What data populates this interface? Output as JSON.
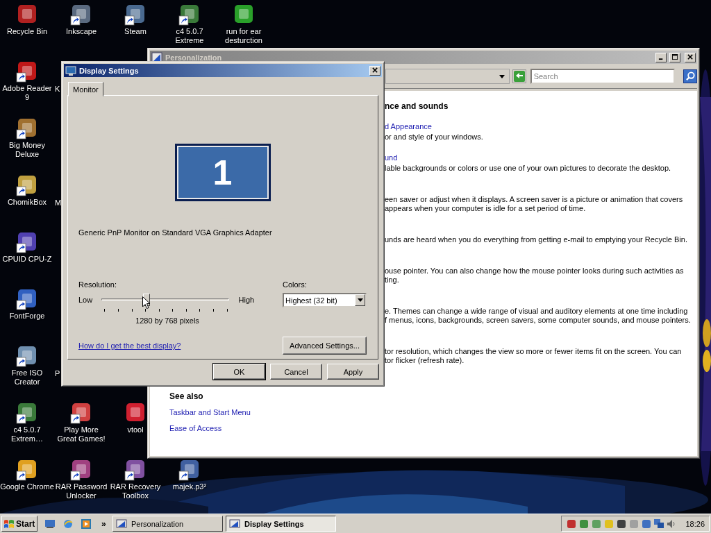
{
  "desktop_icons": [
    {
      "label": "Recycle Bin",
      "shortcut": false
    },
    {
      "label": "Inkscape",
      "shortcut": true
    },
    {
      "label": "Steam",
      "shortcut": true
    },
    {
      "label": "c4 5.0.7 Extreme",
      "shortcut": true
    },
    {
      "label": "run for ear desturction",
      "shortcut": false
    },
    {
      "label": "Adobe Reader 9",
      "shortcut": true
    },
    {
      "label": "K",
      "kind": "partial"
    },
    {
      "label": "Big Money Deluxe",
      "shortcut": true
    },
    {
      "label": "ChomikBox",
      "shortcut": true
    },
    {
      "label": "M",
      "kind": "partial"
    },
    {
      "label": "CPUID CPU-Z",
      "shortcut": true
    },
    {
      "label": "FontForge",
      "shortcut": true
    },
    {
      "label": "Free ISO Creator",
      "shortcut": true
    },
    {
      "label": "P",
      "kind": "partial"
    },
    {
      "label": "c4 5.0.7 Extrem…",
      "shortcut": true
    },
    {
      "label": "Play More Great Games!",
      "shortcut": true
    },
    {
      "label": "vtool",
      "shortcut": false
    },
    {
      "label": "Google Chrome",
      "shortcut": true
    },
    {
      "label": "RAR Password Unlocker",
      "shortcut": true
    },
    {
      "label": "RAR Recovery Toolbox",
      "shortcut": true
    },
    {
      "label": "majek.p3²",
      "shortcut": true
    }
  ],
  "personalization_window": {
    "title": "Personalization",
    "active": false,
    "search": {
      "placeholder": "Search"
    },
    "heading": "nce and sounds",
    "sections": [
      {
        "link": "d Appearance",
        "lines": [
          "or and style of your windows."
        ]
      },
      {
        "link": "und",
        "lines": [
          "lable backgrounds or colors or use one of your own pictures to decorate the desktop."
        ]
      },
      {
        "lines": [
          "een saver or adjust when it displays. A screen saver is a picture or animation that covers",
          "appears when your computer is idle for a set period of time."
        ]
      },
      {
        "lines": [
          "unds are heard when you do everything from getting e-mail to emptying your Recycle Bin."
        ]
      },
      {
        "lines": [
          "ouse pointer. You can also change how the mouse pointer looks during such activities as",
          "ting."
        ]
      },
      {
        "lines": [
          "e. Themes can change a wide range of visual and auditory elements at one time including",
          "f menus, icons, backgrounds, screen savers, some computer sounds, and mouse pointers."
        ]
      },
      {
        "lines": [
          "tor resolution, which changes the view so more or fewer items fit on the screen. You can",
          "tor flicker (refresh rate)."
        ]
      }
    ],
    "see_also": {
      "title": "See also",
      "links": [
        "Taskbar and Start Menu",
        "Ease of Access"
      ]
    }
  },
  "display_settings": {
    "title": "Display Settings",
    "active": true,
    "tabs": [
      {
        "label": "Monitor",
        "selected": true
      }
    ],
    "monitor_number": "1",
    "monitor_name": "Generic PnP Monitor on Standard VGA Graphics Adapter",
    "resolution": {
      "label": "Resolution:",
      "low": "Low",
      "high": "High",
      "level": 0.35,
      "reading": "1280 by 768 pixels"
    },
    "colors": {
      "label": "Colors:",
      "value": "Highest (32 bit)"
    },
    "help_link": "How do I get the best display?",
    "advanced_button": "Advanced Settings...",
    "buttons": [
      {
        "label": "OK",
        "default": true
      },
      {
        "label": "Cancel",
        "default": false
      },
      {
        "label": "Apply",
        "default": false
      }
    ]
  },
  "taskbar": {
    "start": "Start",
    "chevron": "»",
    "tasks": [
      {
        "label": "Personalization",
        "selected": false
      },
      {
        "label": "Display Settings",
        "selected": true
      }
    ],
    "clock": "18:26"
  }
}
